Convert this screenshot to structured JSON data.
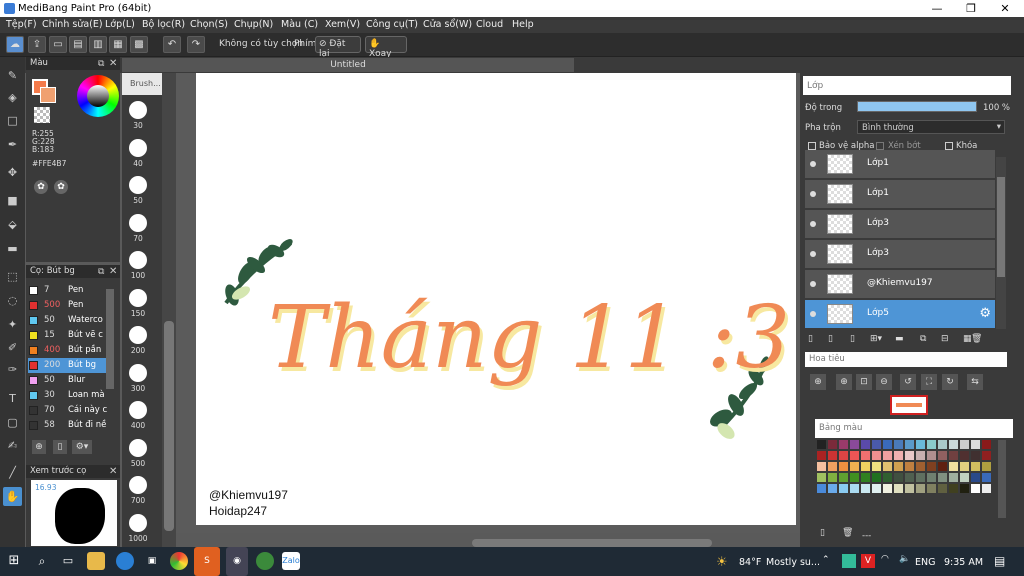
{
  "app": {
    "title": "MediBang Paint Pro (64bit)",
    "document_tab": "Untitled"
  },
  "menu": [
    "Tệp(F)",
    "Chỉnh sửa(E)",
    "Lớp(L)",
    "Bộ lọc(R)",
    "Chọn(S)",
    "Chụp(N)",
    "Màu (C)",
    "Xem(V)",
    "Công cụ(T)",
    "Cửa sổ(W)",
    "Cloud",
    "Help"
  ],
  "toolbar": {
    "no_option": "Không có tùy chọn",
    "key_label": "Phím",
    "reset_label": "Đặt lại",
    "rotate_label": "Xoay"
  },
  "color_panel": {
    "title": "Màu",
    "r": "R:255",
    "g": "G:228",
    "b": "B:183",
    "hex": "#FFE4B7"
  },
  "brush_panel": {
    "title": "Cọ: Bút bg"
  },
  "brushes": [
    {
      "size": "7",
      "name": "Pen",
      "color": "#ffffff"
    },
    {
      "size": "500",
      "name": "Pen",
      "color": "#e03030",
      "size_red": true
    },
    {
      "size": "50",
      "name": "Waterco",
      "color": "#5fc8f0"
    },
    {
      "size": "15",
      "name": "Bút vẽ c",
      "color": "#f0e020"
    },
    {
      "size": "400",
      "name": "Bút pần",
      "color": "#f08020",
      "size_red": true
    },
    {
      "size": "200",
      "name": "Bút bg",
      "color": "#e03030",
      "selected": true
    },
    {
      "size": "50",
      "name": "Blur",
      "color": "#f0a0f0"
    },
    {
      "size": "30",
      "name": "Loan mà",
      "color": "#60c8f0"
    },
    {
      "size": "70",
      "name": "Cái này c",
      "color": "#333333"
    },
    {
      "size": "58",
      "name": "Bút đi nề",
      "color": "#333333"
    }
  ],
  "brush_preview": {
    "title": "Xem trước cọ",
    "value": "16.93"
  },
  "brush_sizes_header": "Brush...",
  "brush_sizes": [
    "30",
    "40",
    "50",
    "70",
    "100",
    "150",
    "200",
    "300",
    "400",
    "500",
    "700",
    "1000"
  ],
  "canvas": {
    "title_text": "Tháng 11 :3",
    "signature1": "@Khiemvu197",
    "signature2": "Hoidap247"
  },
  "layer_panel": {
    "title": "Lớp",
    "opacity_label": "Độ trong",
    "opacity_value": "100 %",
    "opacity_level": 1.0,
    "blend_label": "Pha trộn",
    "blend_value": "Bình thường",
    "protect_alpha": "Bảo vệ alpha",
    "clip": "Xén bớt",
    "lock": "Khóa"
  },
  "layers": [
    {
      "name": "Lớp1"
    },
    {
      "name": "Lớp1"
    },
    {
      "name": "Lớp3"
    },
    {
      "name": "Lớp3"
    },
    {
      "name": "@Khiemvu197"
    },
    {
      "name": "Lớp5",
      "selected": true
    }
  ],
  "navigator": {
    "title": "Hoa tiêu"
  },
  "palette": {
    "title": "Bảng màu",
    "footer": "---"
  },
  "taskbar": {
    "weather": "84°F",
    "weather_desc": "Mostly su...",
    "lang": "ENG",
    "time": "9:35 AM"
  }
}
